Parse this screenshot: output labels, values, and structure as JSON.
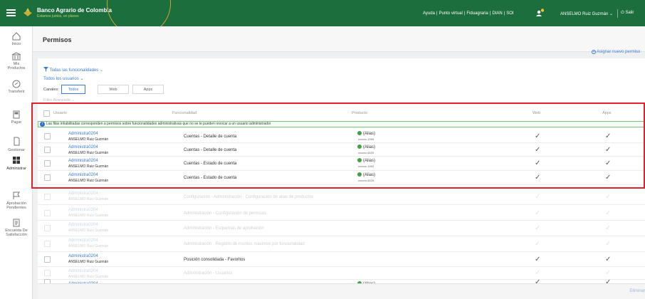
{
  "header": {
    "brand_name": "Banco Agrario de Colombia",
    "brand_tagline": "Estamos juntos, en planes",
    "links": [
      "Ayuda",
      "Punto virtual",
      "Fiduagraria",
      "DIAN",
      "SOI"
    ],
    "link_separator": "|",
    "user_name": "ANSELMO Ruiz Guzmán ⌄",
    "logout_label": "Salir",
    "brand_color": "#1c6e3d"
  },
  "sidebar": {
    "items": [
      {
        "label": "Inicio",
        "icon": "home-icon"
      },
      {
        "label": "Mis Productos",
        "icon": "bank-icon"
      },
      {
        "label": "Transferir",
        "icon": "transfer-icon"
      },
      {
        "label": "Pagar",
        "icon": "payment-terminal-icon"
      },
      {
        "label": "Gestionar",
        "icon": "document-manage-icon"
      },
      {
        "label": "Administrar",
        "icon": "grid-icon"
      },
      {
        "label": "Aprobación Pendientes",
        "icon": "flag-icon"
      },
      {
        "label": "Encuesta De Satisfacción",
        "icon": "survey-icon"
      }
    ]
  },
  "page": {
    "title": "Permisos",
    "assign_label": "Asignar nuevo permiso",
    "filter_label": "Todas las funcionalidades ⌄",
    "users_filter_label": "Todos los usuarios ⌄",
    "channel_label": "Canales:",
    "channels": [
      "Todos",
      "Web",
      "Apps"
    ],
    "active_channel": "Todos",
    "faded_label": "Filtro Avanzado ⌄"
  },
  "table": {
    "columns": [
      "Usuario",
      "Funcionalidad",
      "Producto",
      "Web",
      "Apps"
    ],
    "notice": "Las filas inhabilitadas corresponden a permisos sobre funcionalidades administrativas que no se le pueden revocar a un usuario administrador",
    "rows": [
      {
        "user": "Administra0204",
        "name": "ANSELMO Ruiz Guzmán",
        "func": "Cuentas - Detalle de cuenta",
        "alias": "(Alias)",
        "acct": "xxxxxx-1995",
        "web": "✓",
        "apps": "✓",
        "enabled": true
      },
      {
        "user": "Administra0204",
        "name": "ANSELMO Ruiz Guzmán",
        "func": "Cuentas - Detalle de cuenta",
        "alias": "(Alias)",
        "acct": "xxxxxx-6025",
        "web": "✓",
        "apps": "✓",
        "enabled": true
      },
      {
        "user": "Administra0204",
        "name": "ANSELMO Ruiz Guzmán",
        "func": "Cuentas - Estado de cuenta",
        "alias": "(Alias)",
        "acct": "xxxxxx-1992",
        "web": "✓",
        "apps": "✓",
        "enabled": true
      },
      {
        "user": "Administra0204",
        "name": "ANSELMO Ruiz Guzmán",
        "func": "Cuentas - Estado de cuenta",
        "alias": "(Alias)",
        "acct": "xxxxxx-6025",
        "web": "✓",
        "apps": "✓",
        "enabled": true
      },
      {
        "user": "Administra0204",
        "name": "ANSELMO Ruiz Guzmán",
        "func": "Configuración - Administración - Configuración de alias de productos",
        "alias": "",
        "acct": "",
        "web": "✓",
        "apps": "✓",
        "enabled": false
      },
      {
        "user": "Administra0204",
        "name": "ANSELMO Ruiz Guzmán",
        "func": "Administración - Configuración de permisos",
        "alias": "",
        "acct": "",
        "web": "✓",
        "apps": "✓",
        "enabled": false
      },
      {
        "user": "Administra0204",
        "name": "ANSELMO Ruiz Guzmán",
        "func": "Administración - Esquemas de aprobación",
        "alias": "",
        "acct": "",
        "web": "✓",
        "apps": "✓",
        "enabled": false
      },
      {
        "user": "Administra0204",
        "name": "ANSELMO Ruiz Guzmán",
        "func": "Administración - Registro de montos máximos por funcionalidad",
        "alias": "",
        "acct": "",
        "web": "✓",
        "apps": "✓",
        "enabled": false
      },
      {
        "user": "Administra0204",
        "name": "ANSELMO Ruiz Guzmán",
        "func": "Posición consolidada - Favoritos",
        "alias": "",
        "acct": "",
        "web": "✓",
        "apps": "✓",
        "enabled": true
      },
      {
        "user": "Administra0204",
        "name": "ANSELMO Ruiz Guzmán",
        "func": "Administración - Usuarios",
        "alias": "",
        "acct": "",
        "web": "✓",
        "apps": "✓",
        "enabled": false
      },
      {
        "user": "Administra0204",
        "name": "",
        "func": "",
        "alias": "(Alias)",
        "acct": "",
        "web": "✓",
        "apps": "✓",
        "enabled": true
      }
    ]
  },
  "footer": {
    "delete_label": "Eliminar"
  },
  "colors": {
    "highlight_border": "#e0202c",
    "notice_border": "#7cc37e",
    "link_blue": "#3a7bd5"
  }
}
